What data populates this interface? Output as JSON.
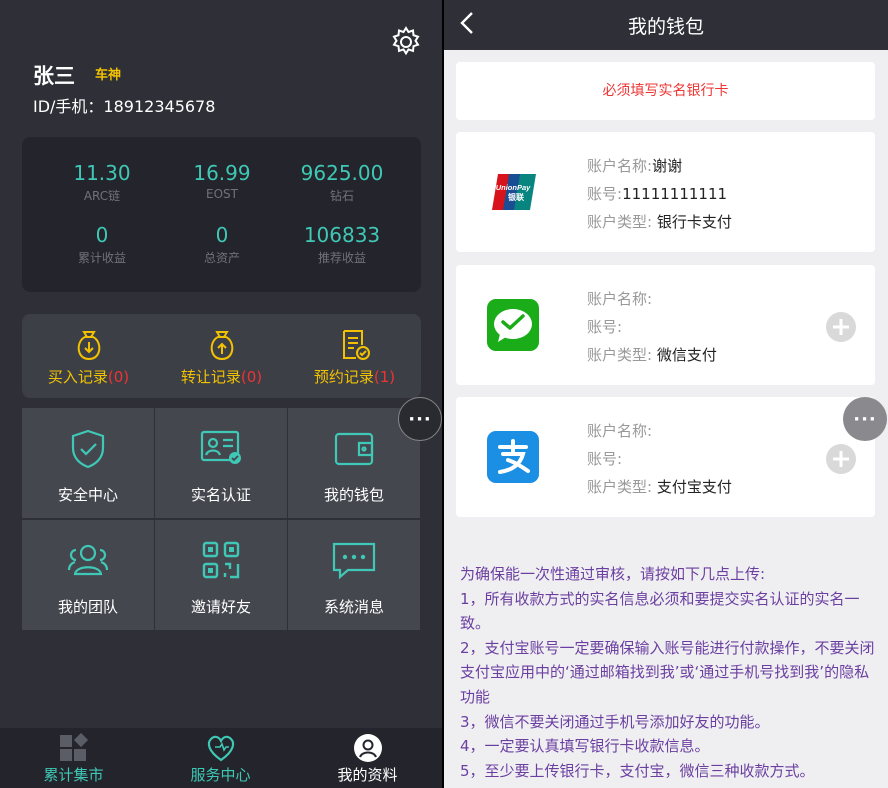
{
  "profile": {
    "name": "张三",
    "badge": "车神",
    "id_label": "ID/手机：18912345678"
  },
  "stats": [
    {
      "value": "11.30",
      "label": "ARC链"
    },
    {
      "value": "16.99",
      "label": "EOST"
    },
    {
      "value": "9625.00",
      "label": "钻石"
    },
    {
      "value": "0",
      "label": "累计收益"
    },
    {
      "value": "0",
      "label": "总资产"
    },
    {
      "value": "106833",
      "label": "推荐收益"
    }
  ],
  "records": [
    {
      "label": "买入记录",
      "count": "(0)",
      "icon": "money-bag-down-icon"
    },
    {
      "label": "转让记录",
      "count": "(0)",
      "icon": "money-bag-up-icon"
    },
    {
      "label": "预约记录",
      "count": "(1)",
      "icon": "document-check-icon"
    }
  ],
  "menu": [
    {
      "label": "安全中心",
      "icon": "shield-check-icon"
    },
    {
      "label": "实名认证",
      "icon": "id-card-icon"
    },
    {
      "label": "我的钱包",
      "icon": "wallet-icon"
    },
    {
      "label": "我的团队",
      "icon": "team-icon"
    },
    {
      "label": "邀请好友",
      "icon": "qr-code-icon"
    },
    {
      "label": "系统消息",
      "icon": "chat-bubble-icon"
    }
  ],
  "tabs": [
    {
      "label": "累计集市",
      "icon": "market-icon"
    },
    {
      "label": "服务中心",
      "icon": "heart-icon"
    },
    {
      "label": "我的资料",
      "icon": "profile-icon"
    }
  ],
  "wallet": {
    "title": "我的钱包",
    "notice": "必须填写实名银行卡",
    "labels": {
      "name": "账户名称:",
      "number": "账号:",
      "type": "账户类型:"
    },
    "accounts": [
      {
        "logo": "unionpay-logo",
        "name": "谢谢",
        "number": "11111111111",
        "type": "银行卡支付"
      },
      {
        "logo": "wechat-pay-logo",
        "name": "",
        "number": "",
        "type": "微信支付"
      },
      {
        "logo": "alipay-logo",
        "name": "",
        "number": "",
        "type": "支付宝支付"
      }
    ],
    "instructions": [
      "为确保能一次性通过审核，请按如下几点上传:",
      "1，所有收款方式的实名信息必须和要提交实名认证的实名一致。",
      "2，支付宝账号一定要确保输入账号能进行付款操作，不要关闭支付宝应用中的‘通过邮箱找到我’或‘通过手机号找到我’的隐私功能",
      "3，微信不要关闭通过手机号添加好友的功能。",
      "4，一定要认真填写银行卡收款信息。",
      "5，至少要上传银行卡，支付宝，微信三种收款方式。"
    ]
  },
  "colors": {
    "accent": "#3fc8b5",
    "gold": "#f2c200",
    "danger": "#ee3333",
    "instruction": "#6b3fa0"
  }
}
